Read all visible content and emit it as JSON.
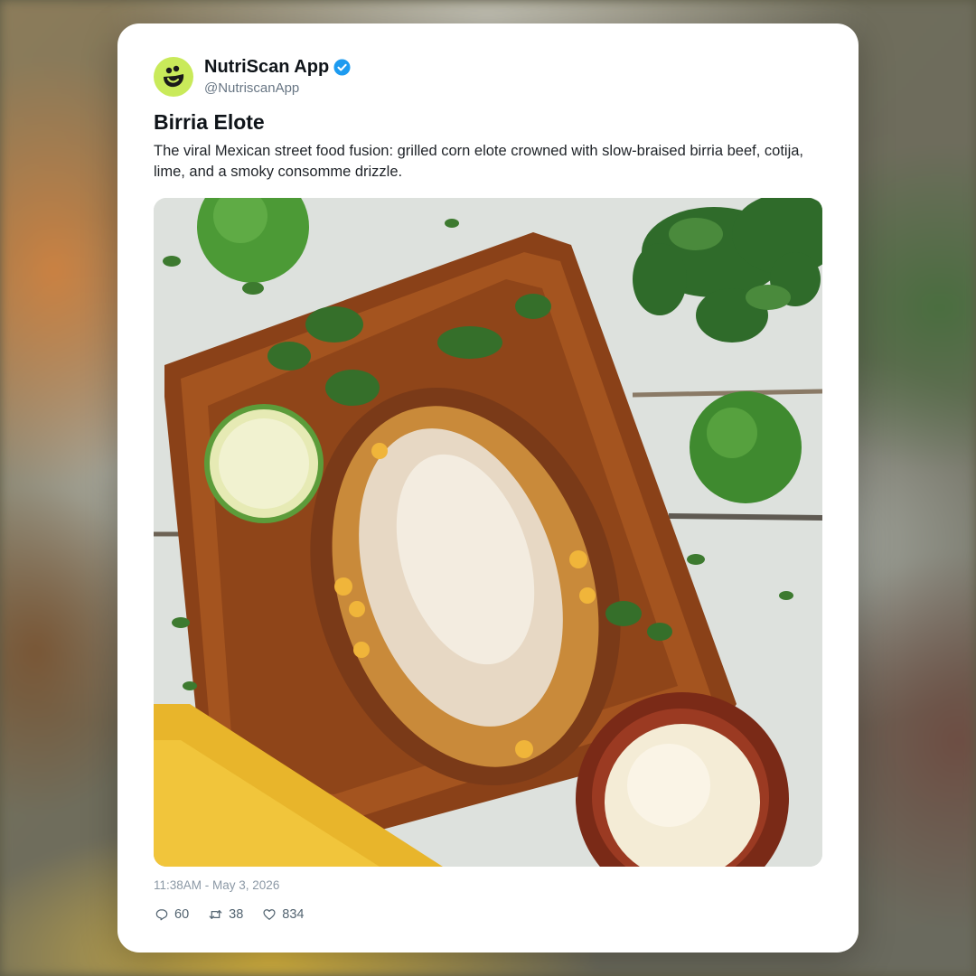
{
  "post": {
    "author_name": "NutriScan App",
    "author_handle": "@NutriscanApp",
    "verified": true,
    "title": "Birria Elote",
    "body": "The viral Mexican street food fusion: grilled corn elote crowned with slow-braised birria beef, cotija, lime, and a smoky consomme drizzle.",
    "timestamp": "11:38AM - May 3, 2026",
    "stats": {
      "replies": "60",
      "reposts": "38",
      "likes": "834"
    }
  },
  "icons": {
    "avatar": "smiley-logo-icon",
    "verified": "verified-badge-icon",
    "reply": "reply-icon",
    "repost": "repost-icon",
    "like": "heart-icon"
  },
  "colors": {
    "avatar_bg": "#c9ea5a",
    "verified_blue": "#1d9bf0",
    "text_primary": "#0f1419",
    "text_secondary": "#687684"
  }
}
